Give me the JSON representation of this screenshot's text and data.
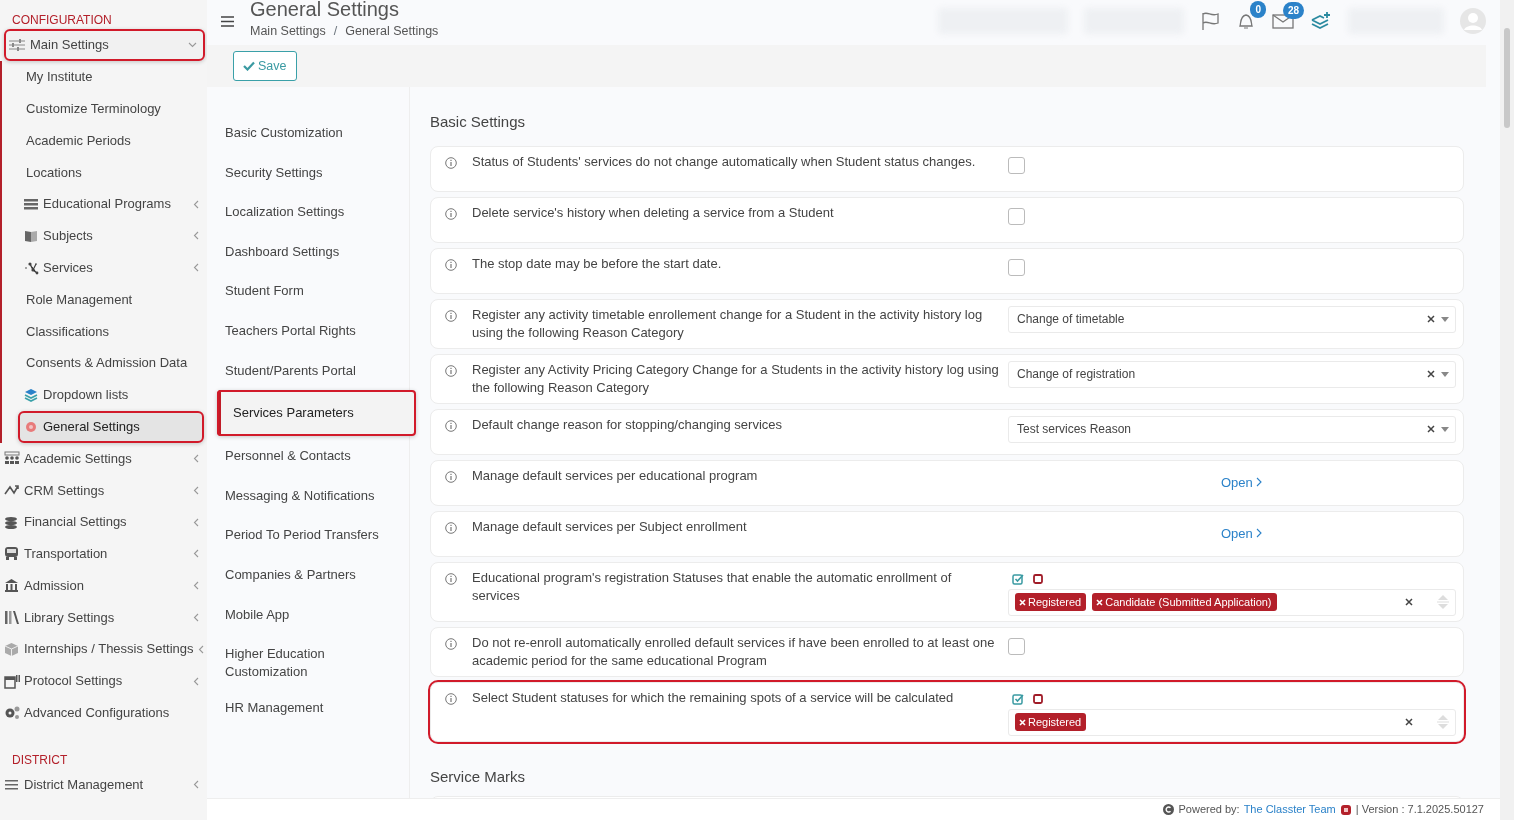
{
  "sidebar": {
    "sections": [
      {
        "title": "CONFIGURATION",
        "items": [
          {
            "label": "Main Settings",
            "expanded": true,
            "highlighted": true,
            "selected": false,
            "has_chevron": true,
            "children": [
              {
                "label": "My Institute",
                "selected": false,
                "highlighted": false,
                "has_chevron": false
              },
              {
                "label": "Customize Terminology",
                "selected": false,
                "highlighted": false,
                "has_chevron": false
              },
              {
                "label": "Academic Periods",
                "selected": false,
                "highlighted": false,
                "has_chevron": false
              },
              {
                "label": "Locations",
                "selected": false,
                "highlighted": false,
                "has_chevron": false
              },
              {
                "label": "Educational Programs",
                "selected": false,
                "highlighted": false,
                "has_chevron": true
              },
              {
                "label": "Subjects",
                "selected": false,
                "highlighted": false,
                "has_chevron": true
              },
              {
                "label": "Services",
                "selected": false,
                "highlighted": false,
                "has_chevron": true
              },
              {
                "label": "Role Management",
                "selected": false,
                "highlighted": false,
                "has_chevron": false
              },
              {
                "label": "Classifications",
                "selected": false,
                "highlighted": false,
                "has_chevron": false
              },
              {
                "label": "Consents & Admission Data",
                "selected": false,
                "highlighted": false,
                "has_chevron": false
              },
              {
                "label": "Dropdown lists",
                "selected": false,
                "highlighted": false,
                "has_chevron": false
              },
              {
                "label": "General Settings",
                "selected": true,
                "highlighted": true,
                "has_chevron": false
              }
            ]
          },
          {
            "label": "Academic Settings",
            "expanded": false,
            "highlighted": false,
            "selected": false,
            "has_chevron": true
          },
          {
            "label": "CRM Settings",
            "expanded": false,
            "highlighted": false,
            "selected": false,
            "has_chevron": true
          },
          {
            "label": "Financial Settings",
            "expanded": false,
            "highlighted": false,
            "selected": false,
            "has_chevron": true
          },
          {
            "label": "Transportation",
            "expanded": false,
            "highlighted": false,
            "selected": false,
            "has_chevron": true
          },
          {
            "label": "Admission",
            "expanded": false,
            "highlighted": false,
            "selected": false,
            "has_chevron": true
          },
          {
            "label": "Library Settings",
            "expanded": false,
            "highlighted": false,
            "selected": false,
            "has_chevron": true
          },
          {
            "label": "Internships / Thessis Settings",
            "expanded": false,
            "highlighted": false,
            "selected": false,
            "has_chevron": true
          },
          {
            "label": "Protocol Settings",
            "expanded": false,
            "highlighted": false,
            "selected": false,
            "has_chevron": true
          },
          {
            "label": "Advanced Configurations",
            "expanded": false,
            "highlighted": false,
            "selected": false,
            "has_chevron": false
          }
        ]
      },
      {
        "title": "DISTRICT",
        "items": [
          {
            "label": "District Management",
            "expanded": false,
            "highlighted": false,
            "selected": false,
            "has_chevron": true
          }
        ]
      }
    ]
  },
  "header": {
    "title": "General Settings",
    "breadcrumb": [
      "Main Settings",
      "General Settings"
    ],
    "breadcrumb_separator": "/",
    "notifications": {
      "count": "0"
    },
    "messages": {
      "count": "28"
    }
  },
  "toolbar": {
    "save_button": "Save"
  },
  "submenu": [
    {
      "label": "Basic Customization",
      "selected": false,
      "highlighted": false
    },
    {
      "label": "Security Settings",
      "selected": false,
      "highlighted": false
    },
    {
      "label": "Localization Settings",
      "selected": false,
      "highlighted": false
    },
    {
      "label": "Dashboard Settings",
      "selected": false,
      "highlighted": false
    },
    {
      "label": "Student Form",
      "selected": false,
      "highlighted": false
    },
    {
      "label": "Teachers Portal Rights",
      "selected": false,
      "highlighted": false
    },
    {
      "label": "Student/Parents Portal",
      "selected": false,
      "highlighted": false
    },
    {
      "label": "Services Parameters",
      "selected": true,
      "highlighted": true
    },
    {
      "label": "Personnel & Contacts",
      "selected": false,
      "highlighted": false
    },
    {
      "label": "Messaging & Notifications",
      "selected": false,
      "highlighted": false
    },
    {
      "label": "Period To Period Transfers",
      "selected": false,
      "highlighted": false
    },
    {
      "label": "Companies & Partners",
      "selected": false,
      "highlighted": false
    },
    {
      "label": "Mobile App",
      "selected": false,
      "highlighted": false
    },
    {
      "label": "Higher Education Customization",
      "selected": false,
      "highlighted": false
    },
    {
      "label": "HR Management",
      "selected": false,
      "highlighted": false
    }
  ],
  "basic_settings": {
    "title": "Basic Settings",
    "rows": [
      {
        "kind": "checkbox",
        "label": "Status of Students' services do not change automatically when Student status changes.",
        "checked": false,
        "highlighted": false
      },
      {
        "kind": "checkbox",
        "label": "Delete service's history when deleting a service from a Student",
        "checked": false,
        "highlighted": false
      },
      {
        "kind": "checkbox",
        "label": "The stop date may be before the start date.",
        "checked": false,
        "highlighted": false
      },
      {
        "kind": "select",
        "label": "Register any activity timetable enrollement change for a Student in the activity history log using the following Reason Category",
        "value": "Change of timetable",
        "highlighted": false
      },
      {
        "kind": "select",
        "label": "Register any Activity Pricing Category Change for a Students in the activity history log using the following Reason Category",
        "value": "Change of registration",
        "highlighted": false
      },
      {
        "kind": "select",
        "label": "Default change reason for stopping/changing services",
        "value": "Test services Reason",
        "highlighted": false
      },
      {
        "kind": "link",
        "label": "Manage default services per educational program",
        "link": "Open",
        "highlighted": false
      },
      {
        "kind": "link",
        "label": "Manage default services per Subject enrollment",
        "link": "Open",
        "highlighted": false
      },
      {
        "kind": "multiselect",
        "label": "Educational program's registration Statuses that enable the automatic enrollment of services",
        "tags": [
          "Registered",
          "Candidate (Submitted Application)"
        ],
        "highlighted": false
      },
      {
        "kind": "checkbox",
        "label": "Do not re-enroll automatically enrolled default services if have been enrolled to at least one academic period for the same educational Program",
        "checked": false,
        "highlighted": false
      },
      {
        "kind": "multiselect",
        "label": "Select Student statuses for which the remaining spots of a service will be calculated",
        "tags": [
          "Registered"
        ],
        "highlighted": true
      }
    ]
  },
  "service_marks": {
    "title": "Service Marks"
  },
  "footer": {
    "powered_by": "Powered by:",
    "team_link": "The Classter Team",
    "version": "| Version : 7.1.2025.50127"
  }
}
